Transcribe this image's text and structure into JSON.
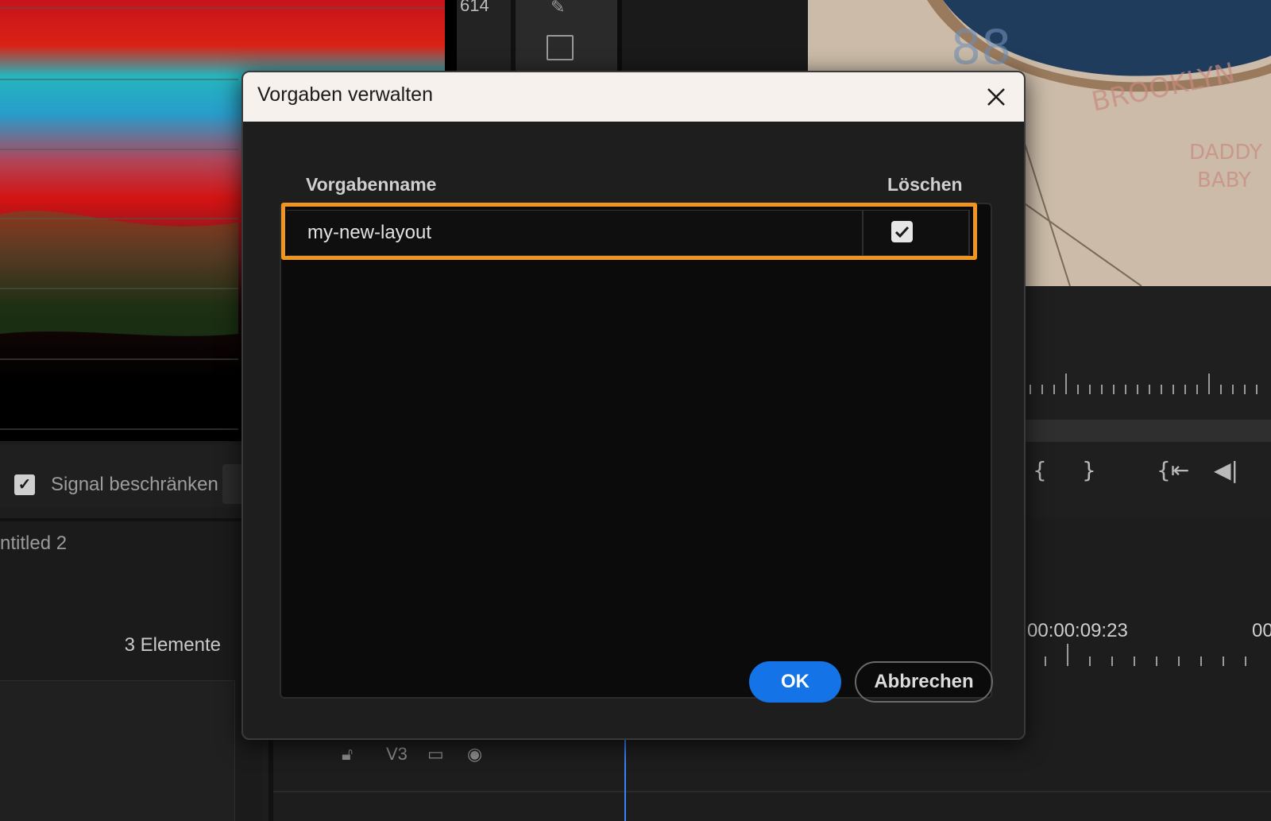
{
  "background": {
    "scope_readout": "614",
    "signal_checkbox_checked": true,
    "signal_label": "Signal beschränken",
    "project_title": "ntitled 2",
    "project_count": "3 Elemente",
    "timecode": "00:00:09:23",
    "timecode_partial": "00",
    "track_label": "V3"
  },
  "dialog": {
    "title": "Vorgaben verwalten",
    "columns": {
      "name": "Vorgabenname",
      "delete": "Löschen"
    },
    "presets": [
      {
        "name": "my-new-layout",
        "delete_checked": true
      }
    ],
    "buttons": {
      "ok": "OK",
      "cancel": "Abbrechen"
    }
  },
  "colors": {
    "highlight": "#f0951f",
    "primary_button": "#1473e6",
    "titlebar": "#f7f1ee"
  },
  "icons": [
    "close-icon",
    "checkmark-icon",
    "lock-icon",
    "eye-icon",
    "track-output-icon",
    "rectangle-tool-icon",
    "pen-tool-icon"
  ]
}
